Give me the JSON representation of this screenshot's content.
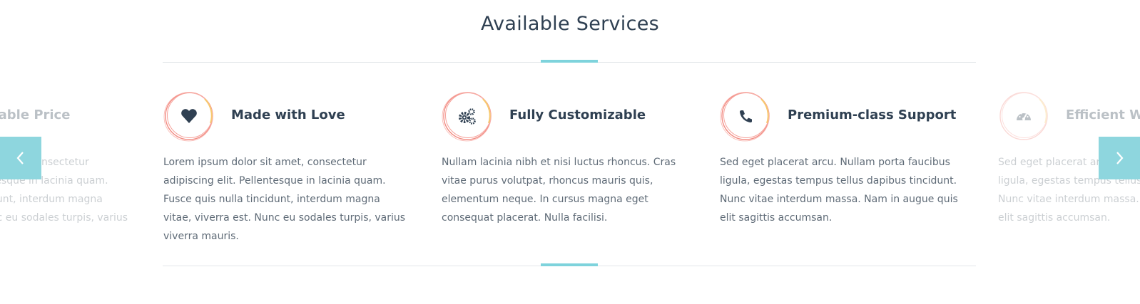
{
  "section": {
    "title": "Available Services"
  },
  "colors": {
    "accent": "#7ed3dc",
    "heading": "#2f4052",
    "text": "#5f6b77",
    "ring": "#f07a7a",
    "arrow_bg": "#8ed6de"
  },
  "cards": [
    {
      "icon": "gauge-icon",
      "title": "Affordable Price",
      "text": "Lorem ipsum dolor sit amet, consectetur adipiscing elit. Pellentesque in lacinia quam. Fusce quis nulla tincidunt, interdum magna vitae, viverra est. Nunc eu sodales turpis, varius viverra mauris.",
      "faded": true
    },
    {
      "icon": "heart-icon",
      "title": "Made with Love",
      "text": "Lorem ipsum dolor sit amet, consectetur adipiscing elit. Pellentesque in lacinia quam. Fusce quis nulla tincidunt, interdum magna vitae, viverra est. Nunc eu sodales turpis, varius viverra mauris."
    },
    {
      "icon": "gears-icon",
      "title": "Fully Customizable",
      "text": "Nullam lacinia nibh et nisi luctus rhoncus. Cras vitae purus volutpat, rhoncus mauris quis, elementum neque. In cursus magna eget consequat placerat. Nulla facilisi."
    },
    {
      "icon": "phone-icon",
      "title": "Premium-class Support",
      "text": "Sed eget placerat arcu. Nullam porta faucibus ligula, egestas tempus tellus dapibus tincidunt. Nunc vitae interdum massa. Nam in augue quis elit sagittis accumsan."
    },
    {
      "icon": "gauge-icon",
      "title": "Efficient Work",
      "text": "Sed eget placerat arcu. Nullam porta faucibus ligula, egestas tempus tellus dapibus tincidunt. Nunc vitae interdum massa. Nam in augue quis elit sagittis accumsan.",
      "faded": true
    }
  ],
  "nav": {
    "prev_icon": "chevron-left-icon",
    "next_icon": "chevron-right-icon"
  }
}
